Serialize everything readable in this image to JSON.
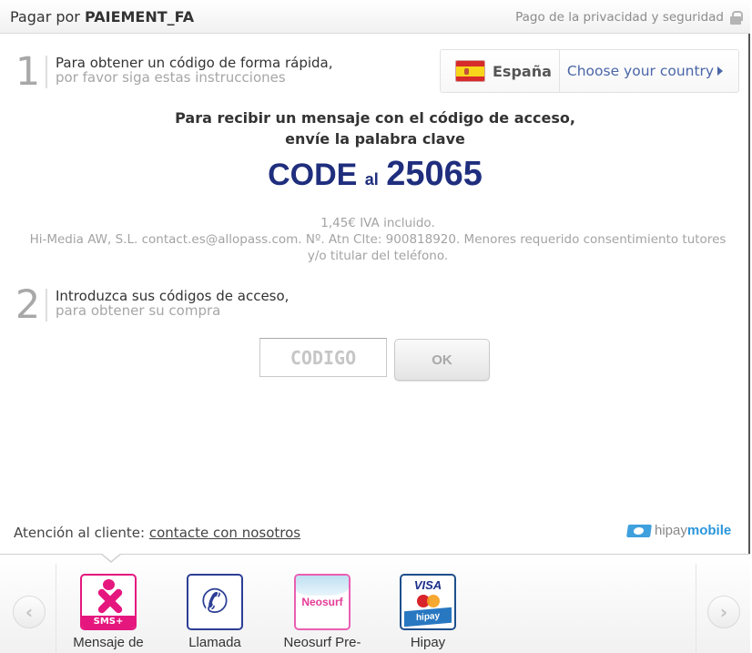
{
  "header": {
    "title_prefix": "Pagar por",
    "title_product": "PAIEMENT_FA",
    "security_label": "Pago de la privacidad y seguridad",
    "security_icon": "lock-icon"
  },
  "step1": {
    "number": "1",
    "line1": "Para obtener un código de forma rápida,",
    "line2": "por favor siga estas instrucciones"
  },
  "country_selector": {
    "flag_icon": "spain-flag-icon",
    "current": "España",
    "choose_label": "Choose your country"
  },
  "instructions": {
    "line1": "Para recibir un mensaje con el código de acceso,",
    "line2": "envíe la palabra clave",
    "keyword": "CODE",
    "connector": "al",
    "short_number": "25065",
    "keyword_color": "#1f2e7d"
  },
  "legal": {
    "price": "1,45€ IVA incluido.",
    "details": "Hi-Media AW, S.L. contact.es@allopass.com. Nº. Atn Clte: 900818920. Menores requerido consentimiento tutores y/o titular del teléfono."
  },
  "step2": {
    "number": "2",
    "line1": "Introduzca sus códigos de acceso,",
    "line2": "para obtener su compra"
  },
  "code_form": {
    "input_value": "",
    "input_placeholder": "CODIGO",
    "submit_label": "OK"
  },
  "footer": {
    "support_label": "Atención al cliente:",
    "support_link": "contacte con nosotros",
    "brand_light": "hipay",
    "brand_bold": "mobile",
    "brand_color": "#2a96dc"
  },
  "payment_methods": {
    "prev_icon": "chevron-left-icon",
    "next_icon": "chevron-right-icon",
    "items": [
      {
        "label": "Mensaje de",
        "icon": "sms-plus-icon",
        "icon_text": "SMS+",
        "selected": true
      },
      {
        "label": "Llamada",
        "icon": "phone-icon",
        "icon_text": "✆",
        "selected": false
      },
      {
        "label": "Neosurf Pre-",
        "icon": "neosurf-icon",
        "icon_text": "Neosurf",
        "selected": false
      },
      {
        "label": "Hipay",
        "icon": "visa-mastercard-hipay-icon",
        "icon_text": "VISA",
        "icon_text2": "hipay",
        "selected": false
      }
    ]
  }
}
